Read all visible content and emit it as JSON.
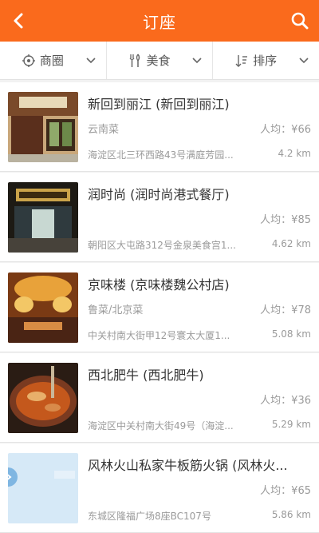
{
  "header": {
    "title": "订座",
    "back_icon": "chevron-left-icon",
    "search_icon": "search-icon"
  },
  "filters": [
    {
      "label": "商圈",
      "icon": "location-pin-icon"
    },
    {
      "label": "美食",
      "icon": "fork-knife-icon"
    },
    {
      "label": "排序",
      "icon": "sort-icon"
    }
  ],
  "restaurants": [
    {
      "name": "新回到丽江 (新回到丽江)",
      "cuisine": "云南菜",
      "price": "人均：¥66",
      "address": "海淀区北三环西路43号满庭芳园...",
      "distance": "4.2 km"
    },
    {
      "name": "润时尚 (润时尚港式餐厅)",
      "cuisine": "",
      "price": "人均：¥85",
      "address": "朝阳区大屯路312号金泉美食宫1...",
      "distance": "4.62 km"
    },
    {
      "name": "京味楼 (京味楼魏公村店)",
      "cuisine": "鲁菜/北京菜",
      "price": "人均：¥78",
      "address": "中关村南大街甲12号寰太大厦1...",
      "distance": "5.08 km"
    },
    {
      "name": "西北肥牛 (西北肥牛)",
      "cuisine": "",
      "price": "人均：¥36",
      "address": "海淀区中关村南大街49号（海淀...",
      "distance": "5.29 km"
    },
    {
      "name": "风林火山私家牛板筋火锅 (风林火...",
      "cuisine": "",
      "price": "人均：¥65",
      "address": "东城区隆福广场8座BC107号",
      "distance": "5.86 km"
    }
  ],
  "colors": {
    "accent": "#fa6a1c"
  }
}
